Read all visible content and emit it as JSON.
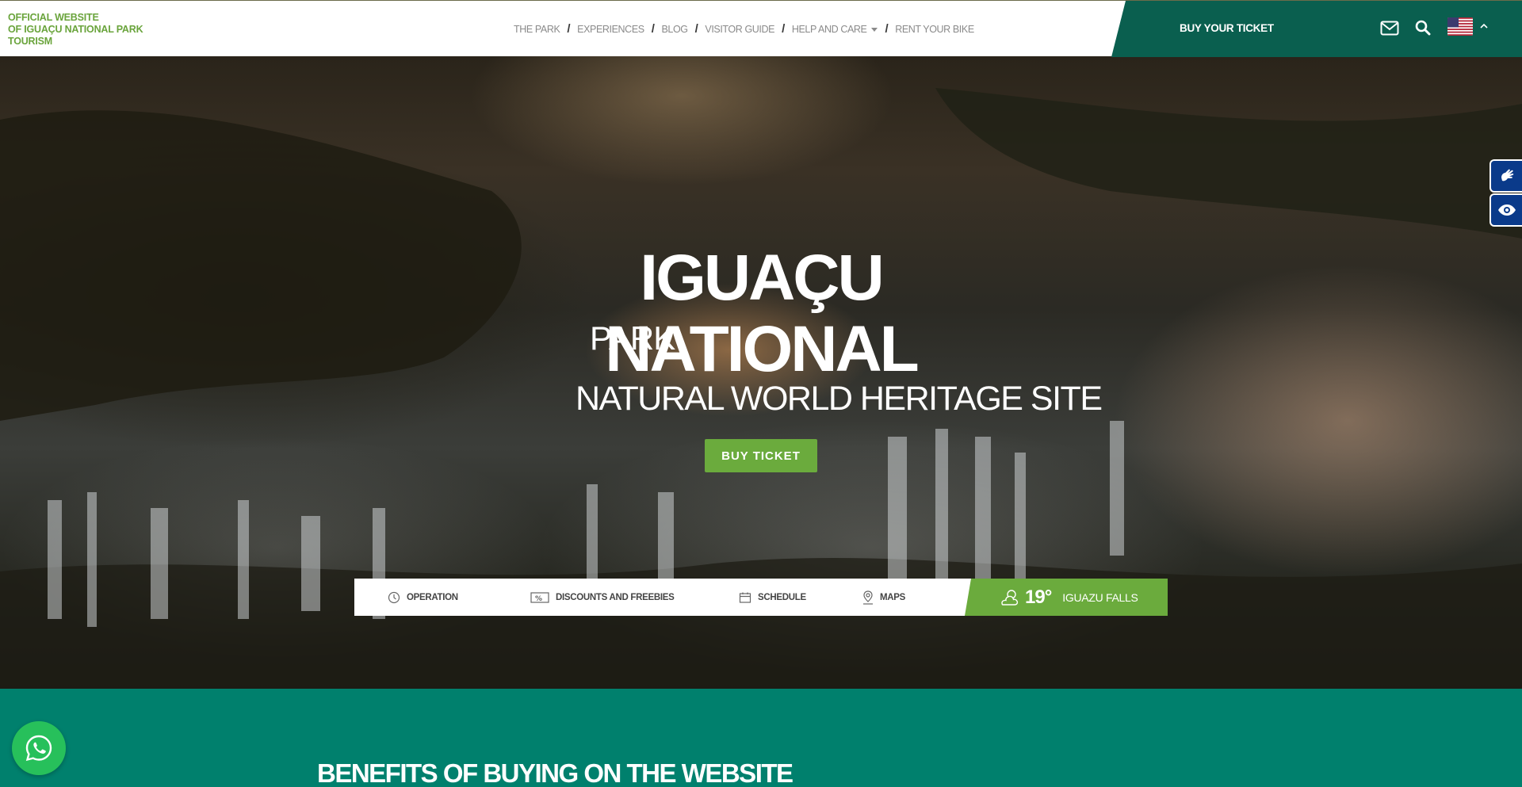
{
  "header": {
    "brand_line1": "OFFICIAL WEBSITE",
    "brand_line2": "OF IGUAÇU NATIONAL PARK",
    "brand_line3": "TOURISM",
    "nav": [
      {
        "label": "THE PARK"
      },
      {
        "label": "EXPERIENCES"
      },
      {
        "label": "BLOG"
      },
      {
        "label": "VISITOR GUIDE"
      },
      {
        "label": "HELP AND CARE"
      },
      {
        "label": "RENT YOUR BIKE"
      }
    ],
    "nav_separator": "/",
    "ticket_label": "BUY YOUR TICKET",
    "icons": {
      "mail": "mail-icon",
      "search": "search-icon",
      "language": "us-flag-icon",
      "toggle": "chevron-up-icon"
    }
  },
  "hero": {
    "title": "IGUAÇU NATIONAL",
    "subtitle1": "PARK",
    "subtitle2": "NATURAL WORLD HERITAGE SITE",
    "cta_label": "BUY TICKET"
  },
  "info_bar": {
    "items": [
      {
        "label": "OPERATION",
        "icon": "clock-icon"
      },
      {
        "label": "DISCOUNTS AND FREEBIES",
        "icon": "percent-ticket-icon"
      },
      {
        "label": "SCHEDULE",
        "icon": "calendar-icon"
      },
      {
        "label": "MAPS",
        "icon": "map-pin-icon"
      }
    ],
    "weather": {
      "temp": "19°",
      "city": "IGUAZU FALLS",
      "icon": "cloud-sun-icon"
    }
  },
  "benefits": {
    "title_light": "BENEFITS OF ",
    "title_bold": "BUYING ON THE WEBSITE"
  },
  "colors": {
    "brand_green": "#6bab3d",
    "dark_teal": "#0a5f4f",
    "section_teal": "#00806d",
    "a11y_blue": "#0a3a8a",
    "whatsapp_green": "#27c05b"
  }
}
